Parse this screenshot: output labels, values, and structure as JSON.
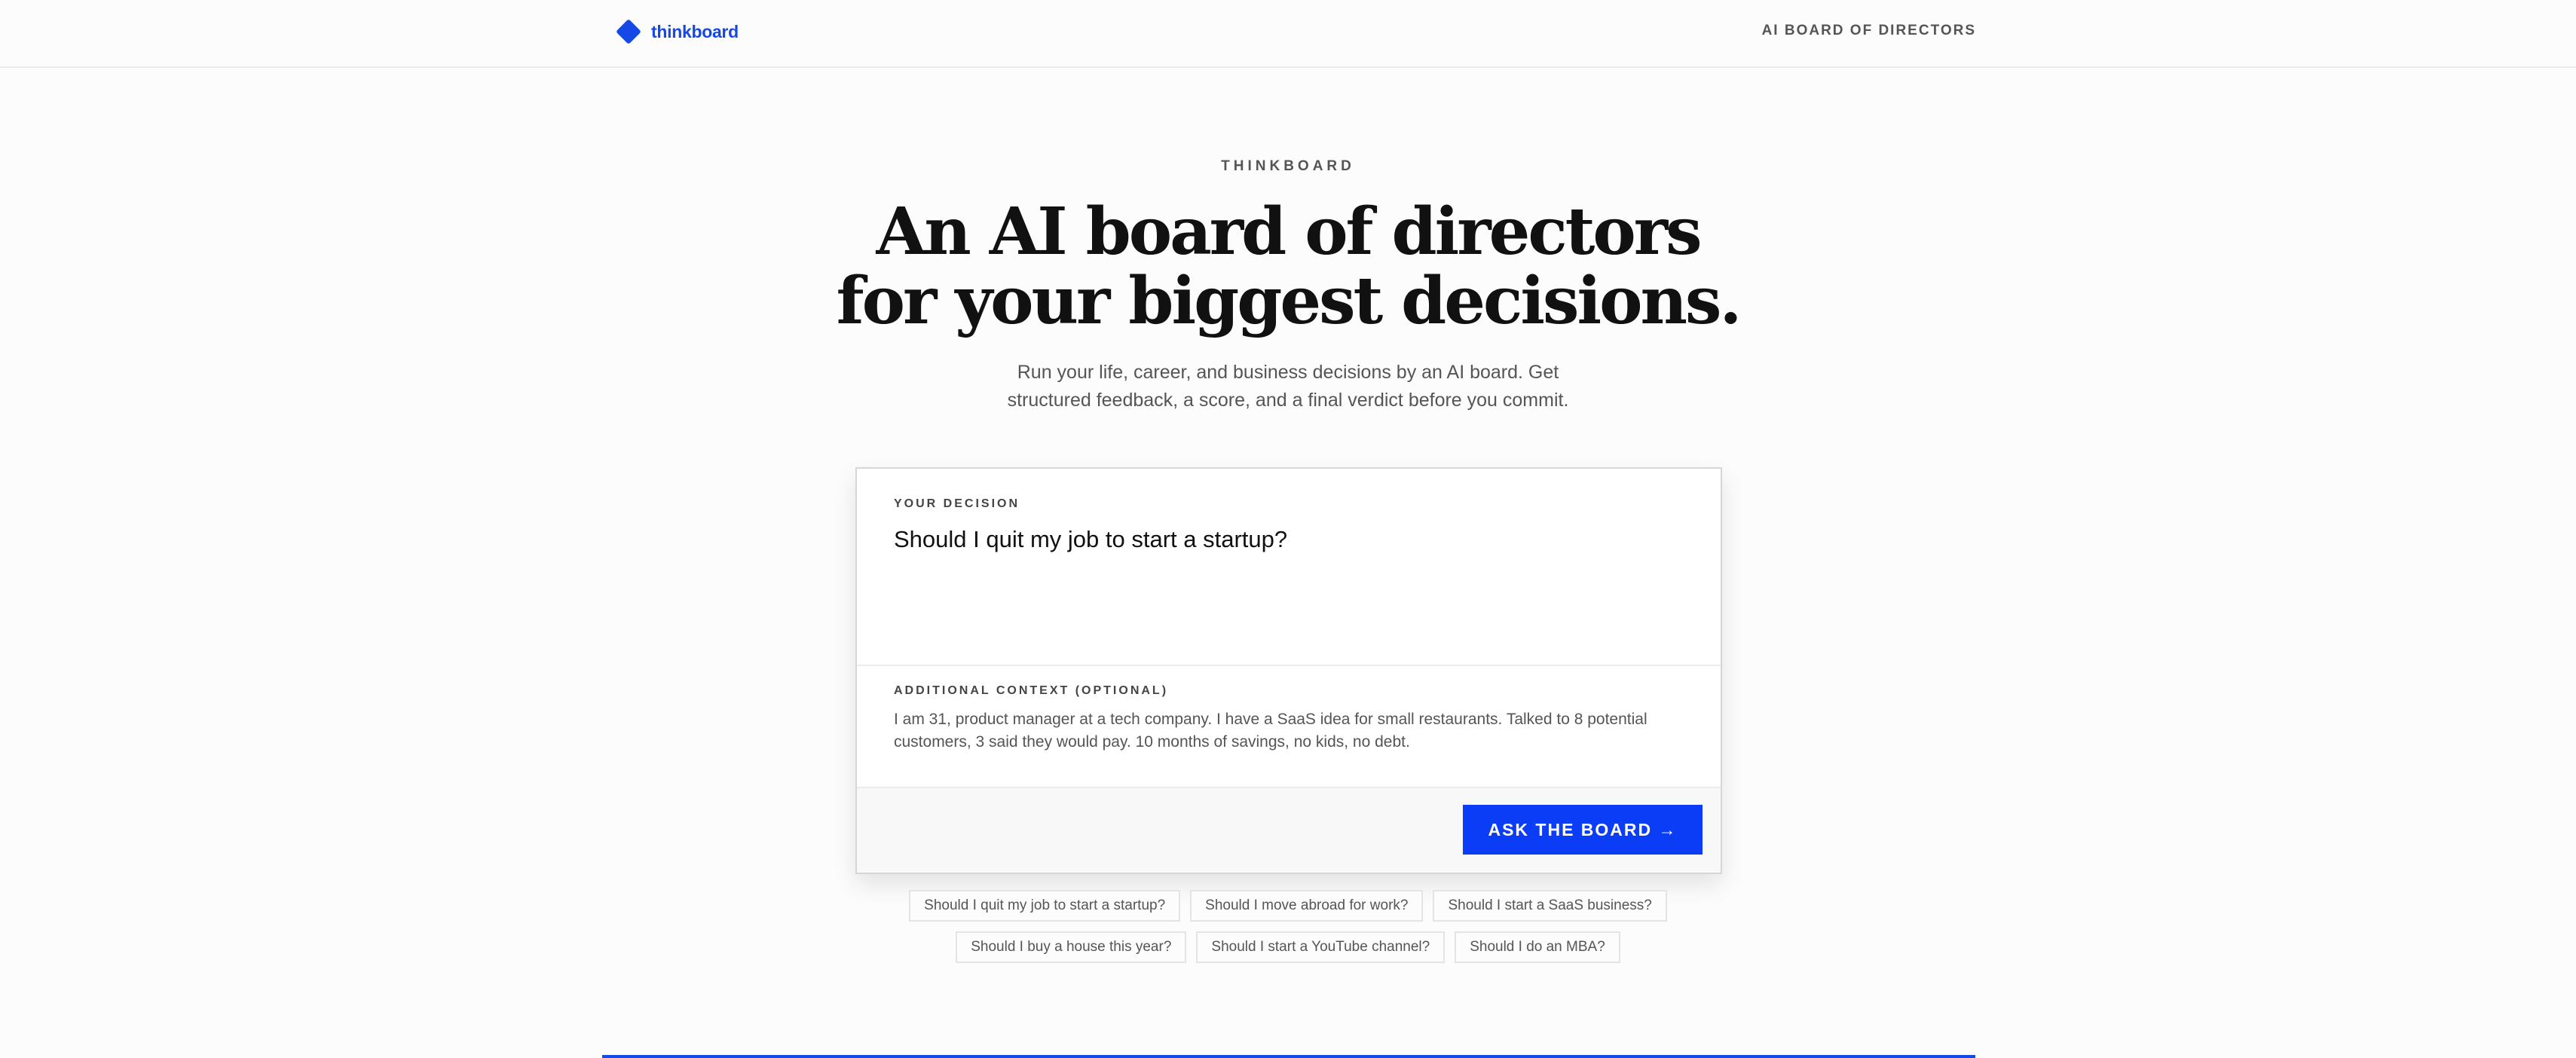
{
  "header": {
    "logo_text": "thinkboard",
    "logo_icon": "diamond-icon",
    "nav_link": "AI BOARD OF DIRECTORS"
  },
  "hero": {
    "eyebrow": "THINKBOARD",
    "headline_line1": "An AI board of directors",
    "headline_line2": "for your biggest decisions.",
    "subhead_line1": "Run your life, career, and business decisions by an AI board. Get",
    "subhead_line2": "structured feedback, a score, and a final verdict before you commit."
  },
  "form": {
    "decision_label": "YOUR DECISION",
    "decision_value": "Should I quit my job to start a startup?",
    "context_label": "ADDITIONAL CONTEXT (OPTIONAL)",
    "context_value": "I am 31, product manager at a tech company. I have a SaaS idea for small restaurants. Talked to 8 potential customers, 3 said they would pay. 10 months of savings, no kids, no debt.",
    "submit_label": "ASK THE BOARD →"
  },
  "suggestions": [
    "Should I quit my job to start a startup?",
    "Should I move abroad for work?",
    "Should I start a SaaS business?",
    "Should I buy a house this year?",
    "Should I start a YouTube channel?",
    "Should I do an MBA?"
  ],
  "colors": {
    "accent": "#0a3df5",
    "brand": "#1549e6"
  }
}
